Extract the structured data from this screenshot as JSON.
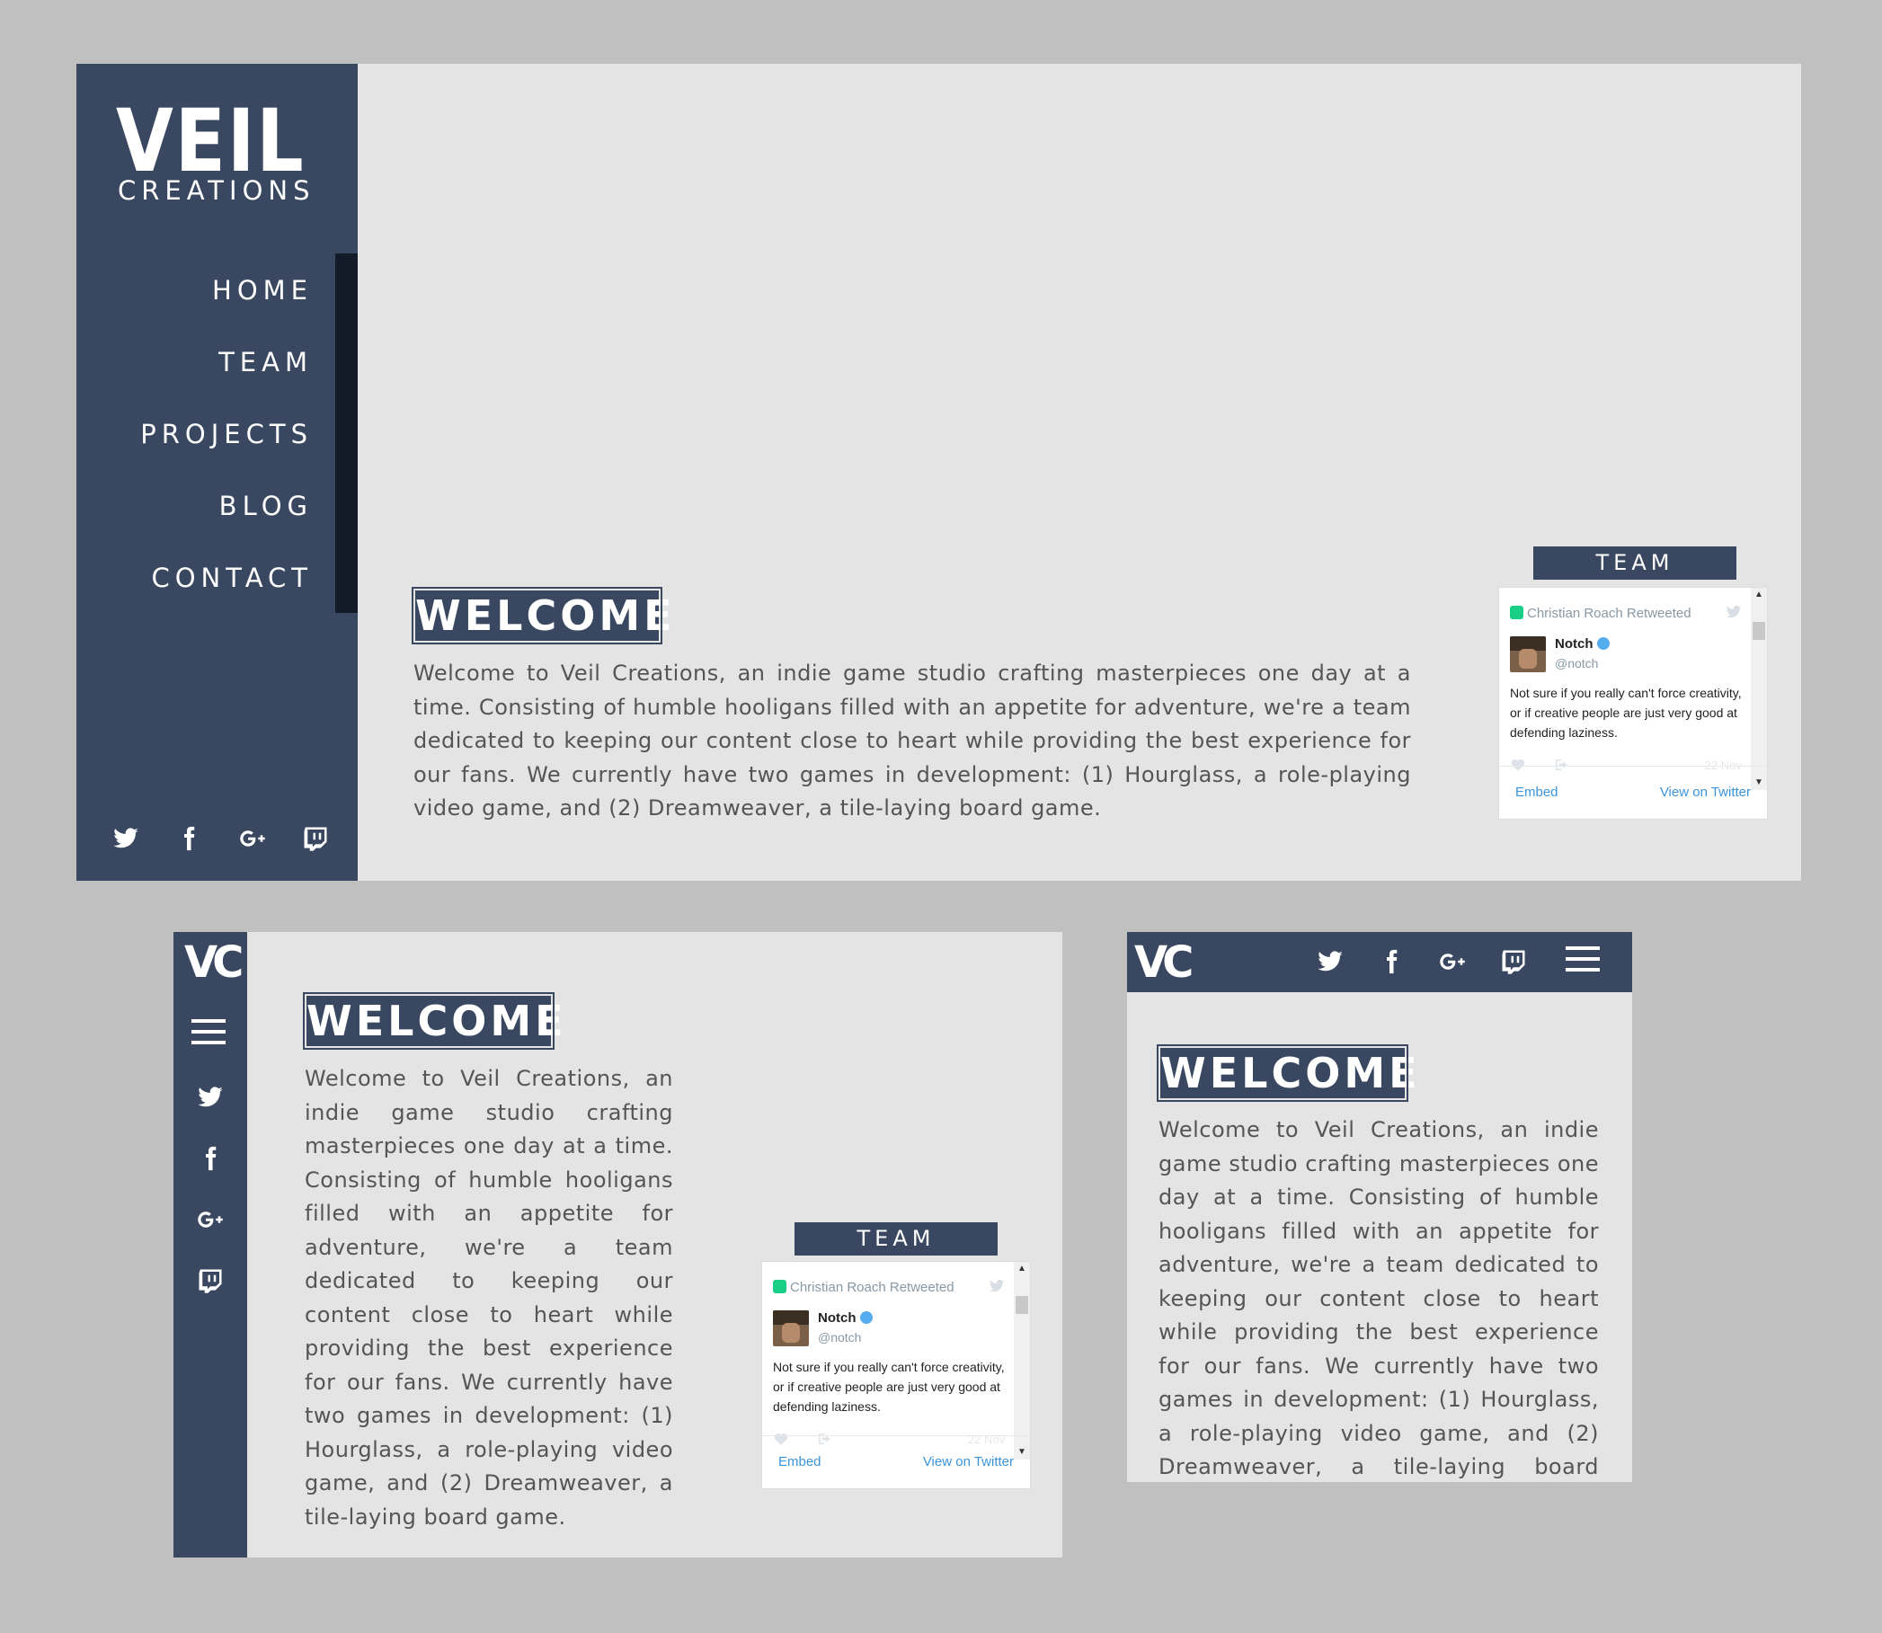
{
  "brand": {
    "logo_main": "VEIL",
    "logo_sub": "CREATIONS",
    "monogram": "VC"
  },
  "nav": {
    "items": [
      "HOME",
      "TEAM",
      "PROJECTS",
      "BLOG",
      "CONTACT"
    ]
  },
  "social_icons": [
    "twitter-icon",
    "facebook-icon",
    "google-plus-icon",
    "twitch-icon"
  ],
  "content": {
    "heading": "WELCOME",
    "body": "Welcome to Veil Creations, an indie game studio crafting masterpieces one day at a time. Consisting of humble hooligans filled with an appetite for adventure, we're a team dedicated to keeping our content close to heart while providing the best experience for our fans. We currently have two games in development: (1) Hourglass, a role-playing video game, and (2) Dreamweaver, a tile-laying board game."
  },
  "tweets": {
    "label": "TEAM TWEETS",
    "retweeted_by": "Christian Roach Retweeted",
    "author_name": "Notch",
    "author_handle": "@notch",
    "text": "Not sure if you really can't force creativity, or if creative people are just very good at defending laziness.",
    "date": "22 Nov",
    "embed_label": "Embed",
    "view_label": "View on Twitter"
  },
  "colors": {
    "navy": "#394860",
    "nav_active_bar": "#131a28",
    "page_bg": "#e4e4e4",
    "canvas_bg": "#c0c0c0",
    "link": "#3b94d9"
  }
}
